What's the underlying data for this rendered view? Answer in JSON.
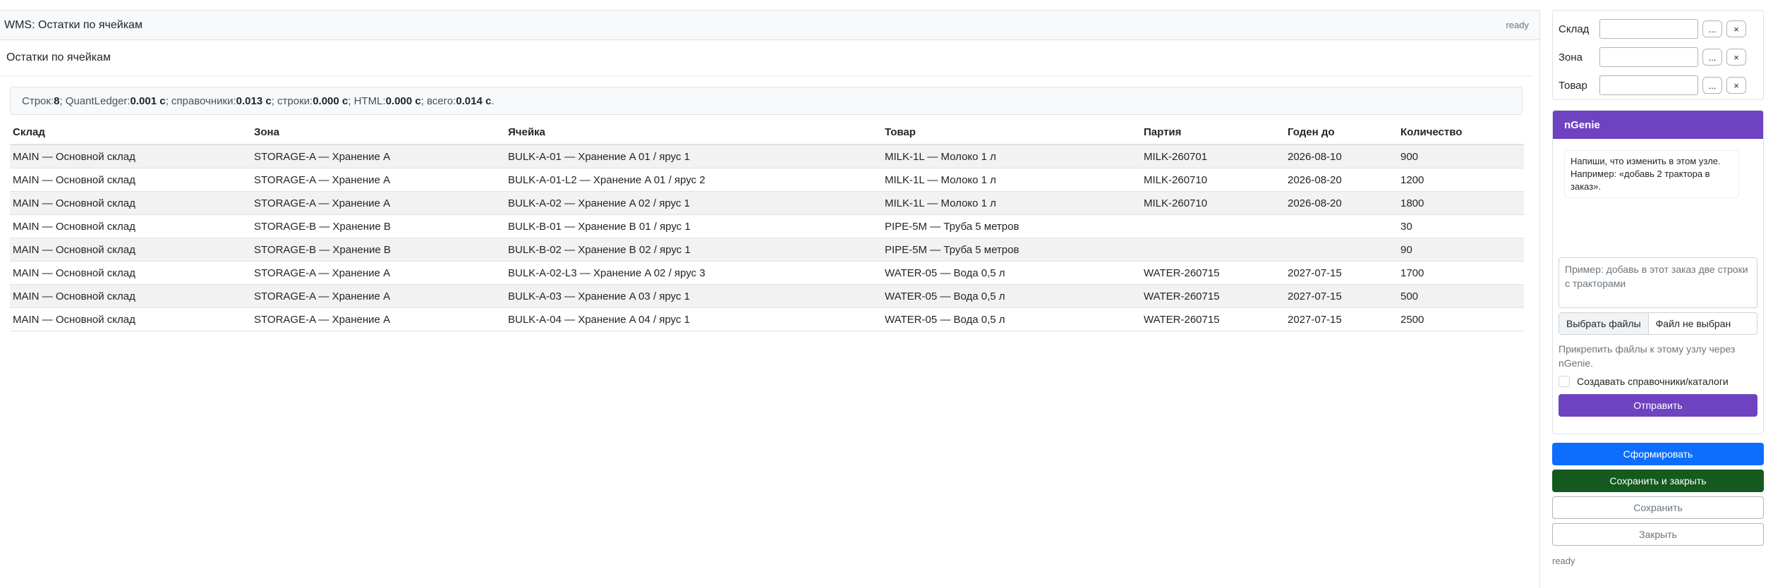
{
  "window": {
    "title": "WMS: Остатки по ячейкам",
    "status": "ready"
  },
  "report": {
    "title": "Остатки по ячейкам",
    "stats": {
      "rows_label": "Строк: ",
      "rows_value": "8",
      "ql_label": "; QuantLedger: ",
      "ql_value": "0.001 с",
      "ref_label": "; справочники: ",
      "ref_value": "0.013 с",
      "str_label": "; строки: ",
      "str_value": "0.000 с",
      "html_label": "; HTML: ",
      "html_value": "0.000 с",
      "total_label": "; всего: ",
      "total_value": "0.014 с",
      "end": "."
    }
  },
  "table": {
    "headers": [
      "Склад",
      "Зона",
      "Ячейка",
      "Товар",
      "Партия",
      "Годен до",
      "Количество"
    ],
    "rows": [
      [
        "MAIN — Основной склад",
        "STORAGE-A — Хранение A",
        "BULK-A-01 — Хранение A 01 / ярус 1",
        "MILK-1L — Молоко 1 л",
        "MILK-260701",
        "2026-08-10",
        "900"
      ],
      [
        "MAIN — Основной склад",
        "STORAGE-A — Хранение A",
        "BULK-A-01-L2 — Хранение A 01 / ярус 2",
        "MILK-1L — Молоко 1 л",
        "MILK-260710",
        "2026-08-20",
        "1200"
      ],
      [
        "MAIN — Основной склад",
        "STORAGE-A — Хранение A",
        "BULK-A-02 — Хранение A 02 / ярус 1",
        "MILK-1L — Молоко 1 л",
        "MILK-260710",
        "2026-08-20",
        "1800"
      ],
      [
        "MAIN — Основной склад",
        "STORAGE-B — Хранение B",
        "BULK-B-01 — Хранение B 01 / ярус 1",
        "PIPE-5M — Труба 5 метров",
        "",
        "",
        "30"
      ],
      [
        "MAIN — Основной склад",
        "STORAGE-B — Хранение B",
        "BULK-B-02 — Хранение B 02 / ярус 1",
        "PIPE-5M — Труба 5 метров",
        "",
        "",
        "90"
      ],
      [
        "MAIN — Основной склад",
        "STORAGE-A — Хранение A",
        "BULK-A-02-L3 — Хранение A 02 / ярус 3",
        "WATER-05 — Вода 0,5 л",
        "WATER-260715",
        "2027-07-15",
        "1700"
      ],
      [
        "MAIN — Основной склад",
        "STORAGE-A — Хранение A",
        "BULK-A-03 — Хранение A 03 / ярус 1",
        "WATER-05 — Вода 0,5 л",
        "WATER-260715",
        "2027-07-15",
        "500"
      ],
      [
        "MAIN — Основной склад",
        "STORAGE-A — Хранение A",
        "BULK-A-04 — Хранение A 04 / ярус 1",
        "WATER-05 — Вода 0,5 л",
        "WATER-260715",
        "2027-07-15",
        "2500"
      ]
    ]
  },
  "filters": [
    {
      "label": "Склад",
      "value": "",
      "pick": "...",
      "clear": "×"
    },
    {
      "label": "Зона",
      "value": "",
      "pick": "...",
      "clear": "×"
    },
    {
      "label": "Товар",
      "value": "",
      "pick": "...",
      "clear": "×"
    }
  ],
  "ngenie": {
    "title": "nGenie",
    "hint": "Напиши, что изменить в этом узле. Например: «добавь 2 трактора в заказ».",
    "placeholder": "Пример: добавь в этот заказ две строки с тракторами",
    "file_button": "Выбрать файлы",
    "file_status": "Файл не выбран",
    "attach_note": "Прикрепить файлы к этому узлу через nGenie.",
    "checkbox_label": "Создавать справочники/каталоги",
    "send": "Отправить"
  },
  "actions": {
    "build": "Сформировать",
    "save_close": "Сохранить и закрыть",
    "save": "Сохранить",
    "close": "Закрыть"
  },
  "status_bottom": "ready",
  "colors": {
    "accent": "#6f42c1",
    "primary": "#0d6efd",
    "success": "#145a1f"
  }
}
